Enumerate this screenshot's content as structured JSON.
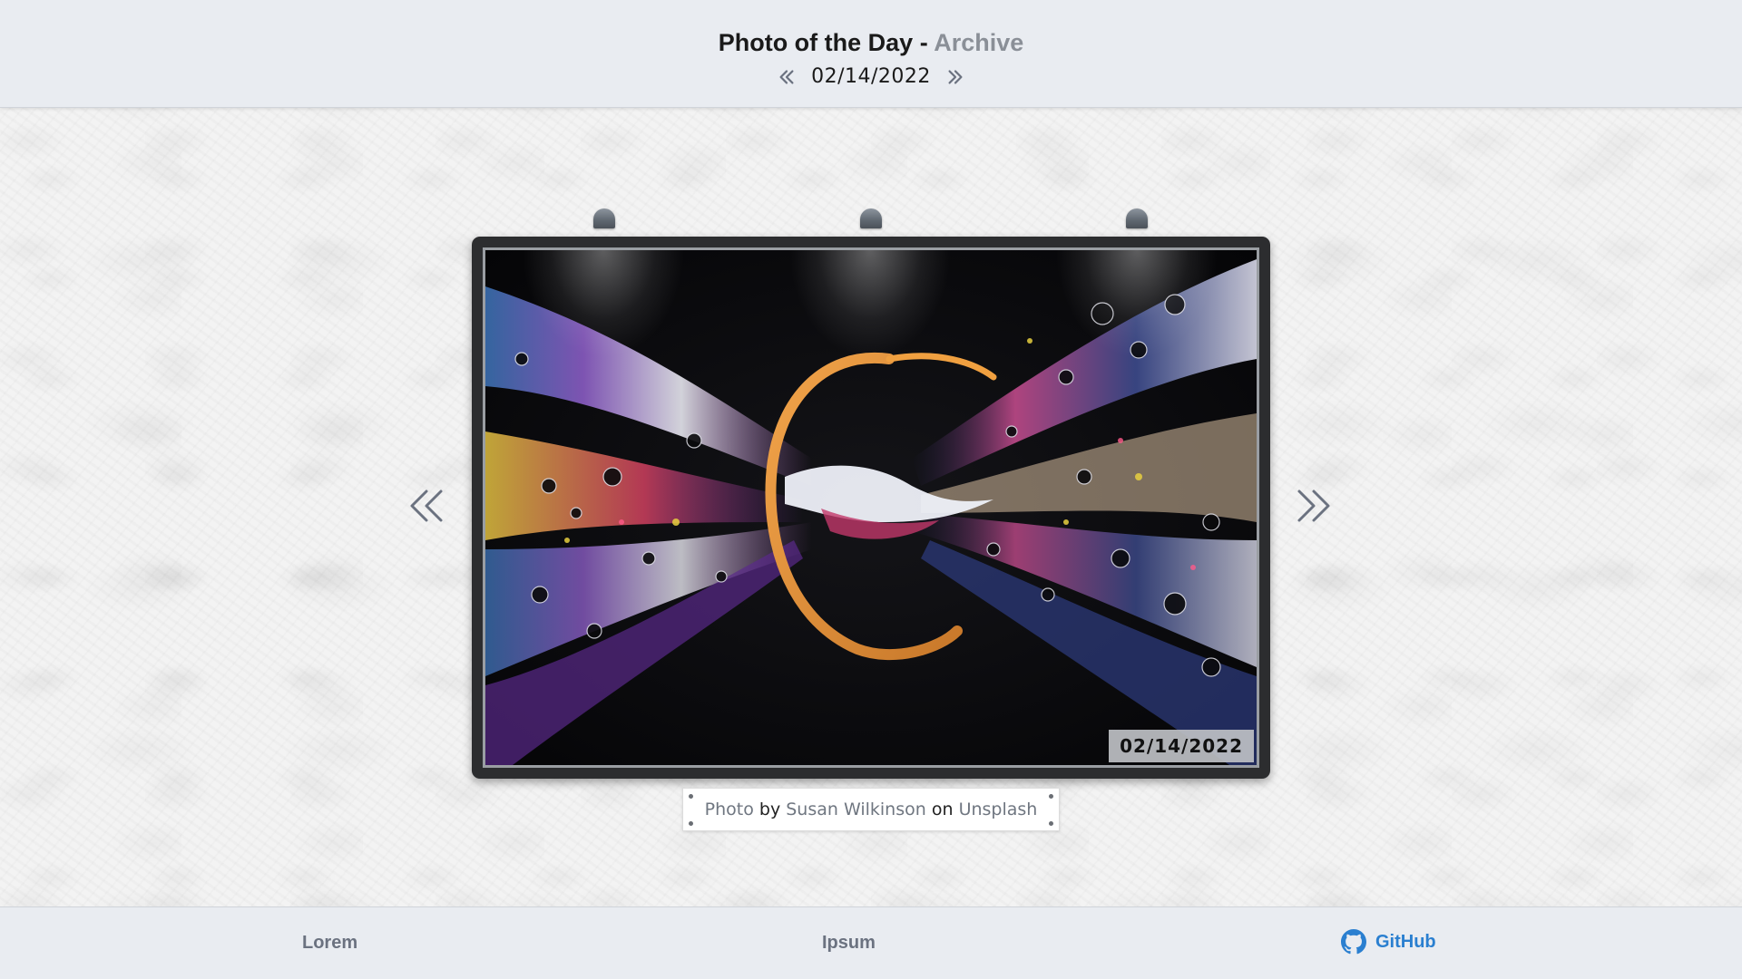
{
  "header": {
    "title": "Photo of the Day",
    "separator": "-",
    "subtitle": "Archive",
    "date": "02/14/2022",
    "prev_icon": "double-chevron-left-icon",
    "next_icon": "double-chevron-right-icon"
  },
  "photo": {
    "date_stamp": "02/14/2022"
  },
  "credit": {
    "photo_link": "Photo",
    "by": "by",
    "author": "Susan Wilkinson",
    "on": "on",
    "source": "Unsplash"
  },
  "footer": {
    "links": [
      {
        "label": "Lorem"
      },
      {
        "label": "Ipsum"
      },
      {
        "label": "GitHub",
        "icon": "github-icon"
      }
    ],
    "accent_color": "#2a7fd0"
  }
}
